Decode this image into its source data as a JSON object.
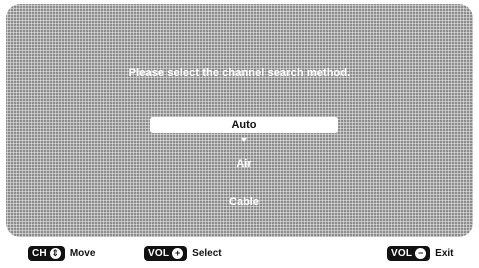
{
  "dialog": {
    "prompt": "Please select the channel search method."
  },
  "options": [
    {
      "label": "Auto",
      "selected": true
    },
    {
      "label": "Air",
      "selected": false
    },
    {
      "label": "Cable",
      "selected": false
    }
  ],
  "footer": {
    "move": {
      "key": "CH",
      "icon": "up-down-arrows-icon",
      "label": "Move"
    },
    "select": {
      "key": "VOL",
      "icon": "plus-icon",
      "label": "Select"
    },
    "exit": {
      "key": "VOL",
      "icon": "minus-icon",
      "label": "Exit"
    }
  },
  "colors": {
    "panel": "#a9a9a9",
    "selected_bg": "#ffffff",
    "key_bg": "#111111"
  }
}
